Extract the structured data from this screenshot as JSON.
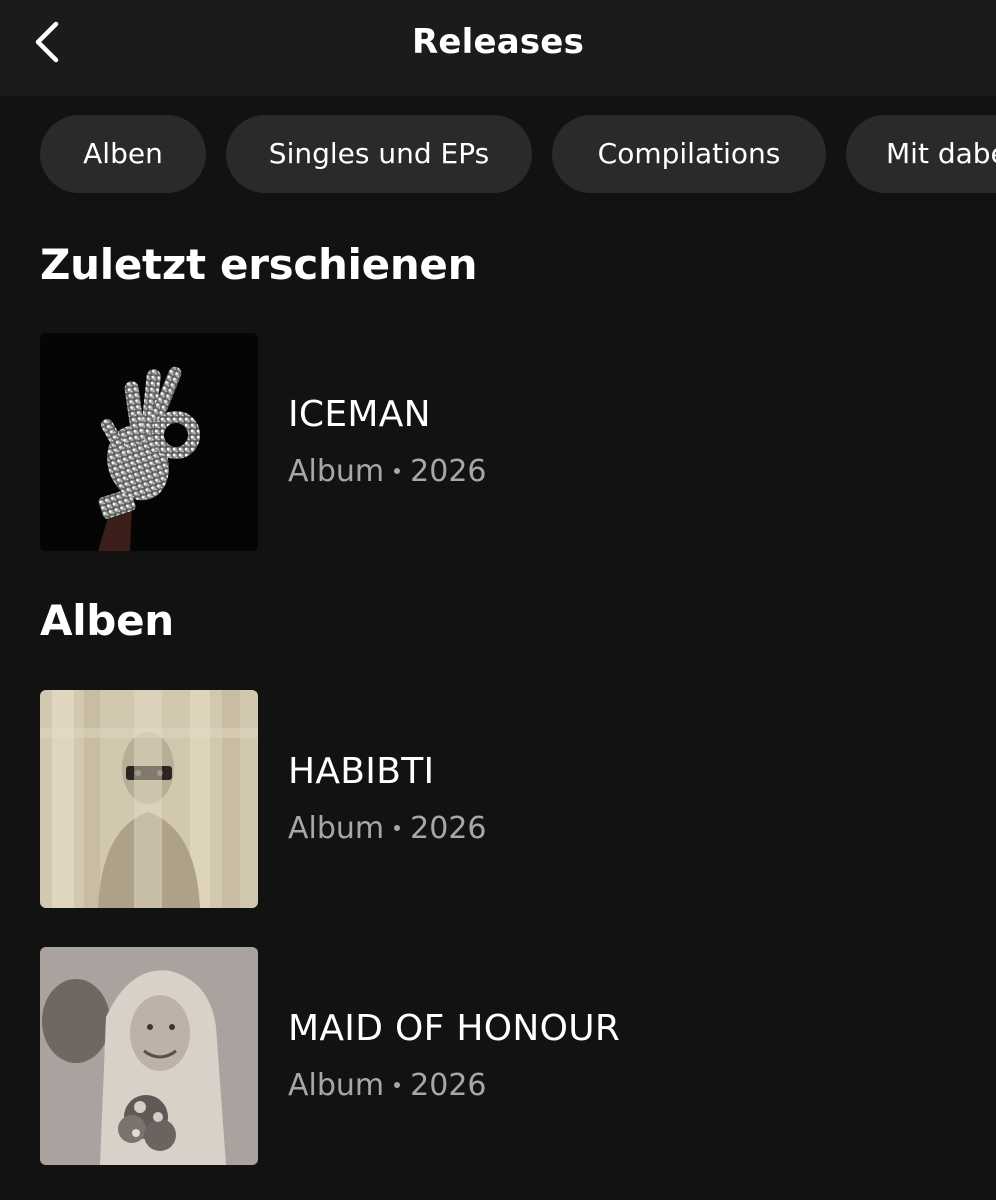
{
  "header": {
    "title": "Releases"
  },
  "filters": [
    {
      "label": "Alben"
    },
    {
      "label": "Singles und EPs"
    },
    {
      "label": "Compilations"
    },
    {
      "label": "Mit dabei"
    }
  ],
  "sections": {
    "recent": {
      "heading": "Zuletzt erschienen",
      "items": [
        {
          "title": "ICEMAN",
          "type": "Album",
          "year": "2026",
          "cover_icon": "jeweled-glove-ok-hand-artwork"
        }
      ]
    },
    "albums": {
      "heading": "Alben",
      "items": [
        {
          "title": "HABIBTI",
          "type": "Album",
          "year": "2026",
          "cover_icon": "taped-portrait-artwork"
        },
        {
          "title": "MAID OF HONOUR",
          "type": "Album",
          "year": "2026",
          "cover_icon": "sepia-portrait-artwork"
        }
      ]
    }
  },
  "colors": {
    "background": "#121212",
    "header": "#1b1b1b",
    "chip": "#2a2a2a",
    "secondary_text": "#a7a7a7"
  }
}
